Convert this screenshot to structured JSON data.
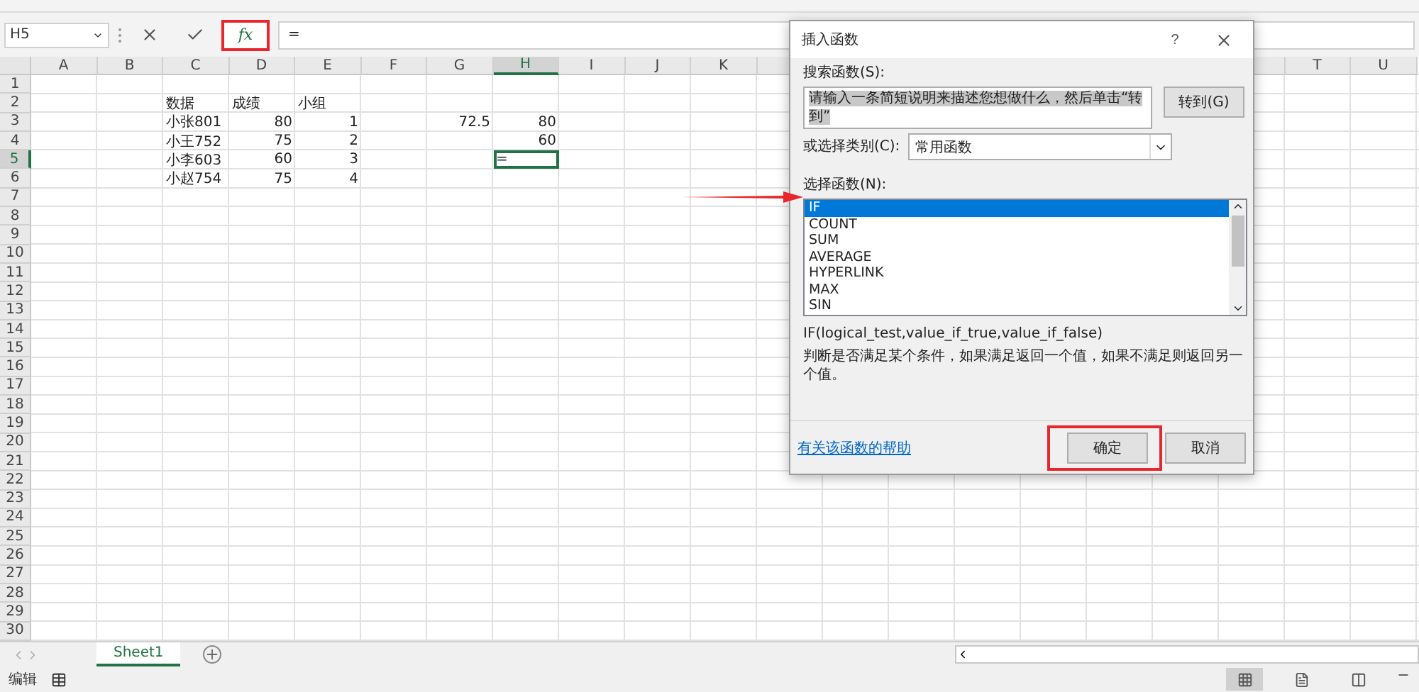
{
  "formula_bar": {
    "name_box": "H5",
    "fx_label": "fx",
    "fx_highlighted": true,
    "formula": "="
  },
  "sheet": {
    "columns_left": [
      {
        "label": "A",
        "selected": false
      },
      {
        "label": "B",
        "selected": false
      },
      {
        "label": "C",
        "selected": false
      },
      {
        "label": "D",
        "selected": false
      },
      {
        "label": "E",
        "selected": false
      },
      {
        "label": "F",
        "selected": false
      },
      {
        "label": "G",
        "selected": false
      },
      {
        "label": "H",
        "selected": true
      },
      {
        "label": "I",
        "selected": false
      },
      {
        "label": "J",
        "selected": false
      },
      {
        "label": "K",
        "selected": false
      }
    ],
    "columns_right": [
      {
        "label": "T",
        "selected": false
      },
      {
        "label": "U",
        "selected": false
      }
    ],
    "rows": [
      {
        "number": "1",
        "selected": false
      },
      {
        "number": "2",
        "selected": false,
        "cells": [
          {
            "kind": "empty",
            "selected": false
          },
          {
            "kind": "empty",
            "selected": false
          },
          {
            "kind": "text",
            "text": "数据",
            "selected": false
          },
          {
            "kind": "text",
            "text": "成绩",
            "selected": false
          },
          {
            "kind": "text",
            "text": "小组",
            "selected": false
          }
        ]
      },
      {
        "number": "3",
        "selected": false,
        "cells": [
          {
            "kind": "empty",
            "selected": false
          },
          {
            "kind": "empty",
            "selected": false
          },
          {
            "kind": "text",
            "text": "小张801",
            "selected": false
          },
          {
            "kind": "number",
            "text": "80",
            "selected": false
          },
          {
            "kind": "number",
            "text": "1",
            "selected": false
          },
          {
            "kind": "empty",
            "selected": false
          },
          {
            "kind": "number",
            "text": "72.5",
            "selected": false
          },
          {
            "kind": "number",
            "text": "80",
            "selected": false
          }
        ]
      },
      {
        "number": "4",
        "selected": false,
        "cells": [
          {
            "kind": "empty",
            "selected": false
          },
          {
            "kind": "empty",
            "selected": false
          },
          {
            "kind": "text",
            "text": "小王752",
            "selected": false
          },
          {
            "kind": "number",
            "text": "75",
            "selected": false
          },
          {
            "kind": "number",
            "text": "2",
            "selected": false
          },
          {
            "kind": "empty",
            "selected": false
          },
          {
            "kind": "empty",
            "selected": false
          },
          {
            "kind": "number",
            "text": "60",
            "selected": false
          }
        ]
      },
      {
        "number": "5",
        "selected": true,
        "cells": [
          {
            "kind": "empty",
            "selected": false
          },
          {
            "kind": "empty",
            "selected": false
          },
          {
            "kind": "text",
            "text": "小李603",
            "selected": false
          },
          {
            "kind": "number",
            "text": "60",
            "selected": false
          },
          {
            "kind": "number",
            "text": "3",
            "selected": false
          },
          {
            "kind": "empty",
            "selected": false
          },
          {
            "kind": "empty",
            "selected": false
          },
          {
            "kind": "text",
            "text": "=",
            "selected": true
          }
        ]
      },
      {
        "number": "6",
        "selected": false,
        "cells": [
          {
            "kind": "empty",
            "selected": false
          },
          {
            "kind": "empty",
            "selected": false
          },
          {
            "kind": "text",
            "text": "小赵754",
            "selected": false
          },
          {
            "kind": "number",
            "text": "75",
            "selected": false
          },
          {
            "kind": "number",
            "text": "4",
            "selected": false
          }
        ]
      },
      {
        "number": "7",
        "selected": false
      },
      {
        "number": "8",
        "selected": false
      },
      {
        "number": "9",
        "selected": false
      },
      {
        "number": "10",
        "selected": false
      },
      {
        "number": "11",
        "selected": false
      },
      {
        "number": "12",
        "selected": false
      },
      {
        "number": "13",
        "selected": false
      },
      {
        "number": "14",
        "selected": false
      },
      {
        "number": "15",
        "selected": false
      },
      {
        "number": "16",
        "selected": false
      },
      {
        "number": "17",
        "selected": false
      },
      {
        "number": "18",
        "selected": false
      },
      {
        "number": "19",
        "selected": false
      },
      {
        "number": "20",
        "selected": false
      },
      {
        "number": "21",
        "selected": false
      },
      {
        "number": "22",
        "selected": false
      },
      {
        "number": "23",
        "selected": false
      },
      {
        "number": "24",
        "selected": false
      },
      {
        "number": "25",
        "selected": false
      },
      {
        "number": "26",
        "selected": false
      },
      {
        "number": "27",
        "selected": false
      },
      {
        "number": "28",
        "selected": false
      },
      {
        "number": "29",
        "selected": false
      },
      {
        "number": "30",
        "selected": false
      }
    ]
  },
  "dialog": {
    "title": "插入函数",
    "help": "?",
    "search_label": "搜索函数(S):",
    "search_value": "请输入一条简短说明来描述您想做什么，然后单击“转到”",
    "search_text_selected": true,
    "go_button": "转到(G)",
    "category_label": "或选择类别(C):",
    "category_value": "常用函数",
    "list_label": "选择函数(N):",
    "list_pointed": true,
    "functions": [
      {
        "name": "IF",
        "selected": true
      },
      {
        "name": "COUNT",
        "selected": false
      },
      {
        "name": "SUM",
        "selected": false
      },
      {
        "name": "AVERAGE",
        "selected": false
      },
      {
        "name": "HYPERLINK",
        "selected": false
      },
      {
        "name": "MAX",
        "selected": false
      },
      {
        "name": "SIN",
        "selected": false
      }
    ],
    "syntax": "IF(logical_test,value_if_true,value_if_false)",
    "description": "判断是否满足某个条件，如果满足返回一个值，如果不满足则返回另一个值。",
    "help_link": "有关该函数的帮助",
    "buttons": [
      {
        "label": "确定",
        "highlighted": true
      },
      {
        "label": "取消",
        "highlighted": false
      }
    ]
  },
  "sheet_tabs": [
    {
      "label": "Sheet1",
      "selected": true
    }
  ],
  "status_bar": {
    "mode": "编辑",
    "views": [
      {
        "kind": "normal",
        "selected": true
      },
      {
        "kind": "page_layout",
        "selected": false
      },
      {
        "kind": "page_break",
        "selected": false
      }
    ]
  }
}
